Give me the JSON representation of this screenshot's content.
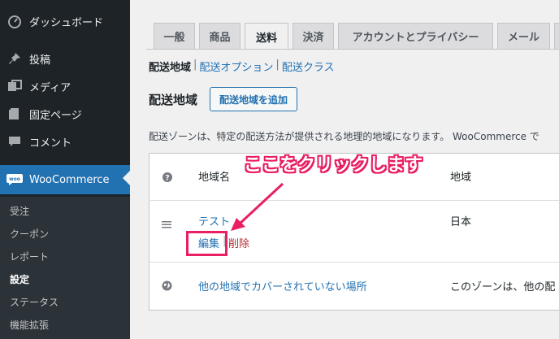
{
  "sidebar": {
    "items": [
      {
        "label": "ダッシュボード",
        "icon": "dashboard-icon"
      },
      {
        "label": "投稿",
        "icon": "pin-icon"
      },
      {
        "label": "メディア",
        "icon": "media-icon"
      },
      {
        "label": "固定ページ",
        "icon": "page-icon"
      },
      {
        "label": "コメント",
        "icon": "comment-icon"
      }
    ],
    "woocommerce": {
      "label": "WooCommerce",
      "icon": "woo-icon"
    },
    "submenu": [
      "受注",
      "クーポン",
      "レポート",
      "設定",
      "ステータス",
      "機能拡張"
    ]
  },
  "tabs": [
    "一般",
    "商品",
    "送料",
    "決済",
    "アカウントとプライバシー",
    "メール",
    "連"
  ],
  "subsub": {
    "current": "配送地域",
    "links": [
      "配送オプション",
      "配送クラス"
    ],
    "sep": "|"
  },
  "page": {
    "title": "配送地域",
    "add_button": "配送地域を追加",
    "description": "配送ゾーンは、特定の配送方法が提供される地理的地域になります。 WooCommerce で"
  },
  "table": {
    "headers": {
      "name": "地域名",
      "region": "地域"
    },
    "rows": [
      {
        "name": "テスト",
        "region": "日本",
        "edit": "編集",
        "sep": "|",
        "delete": "削除"
      },
      {
        "name": "他の地域でカバーされていない場所",
        "region": "このゾーンは、他の配"
      }
    ]
  },
  "annotation": {
    "text": "ここをクリックします",
    "color": "#e91e63"
  }
}
